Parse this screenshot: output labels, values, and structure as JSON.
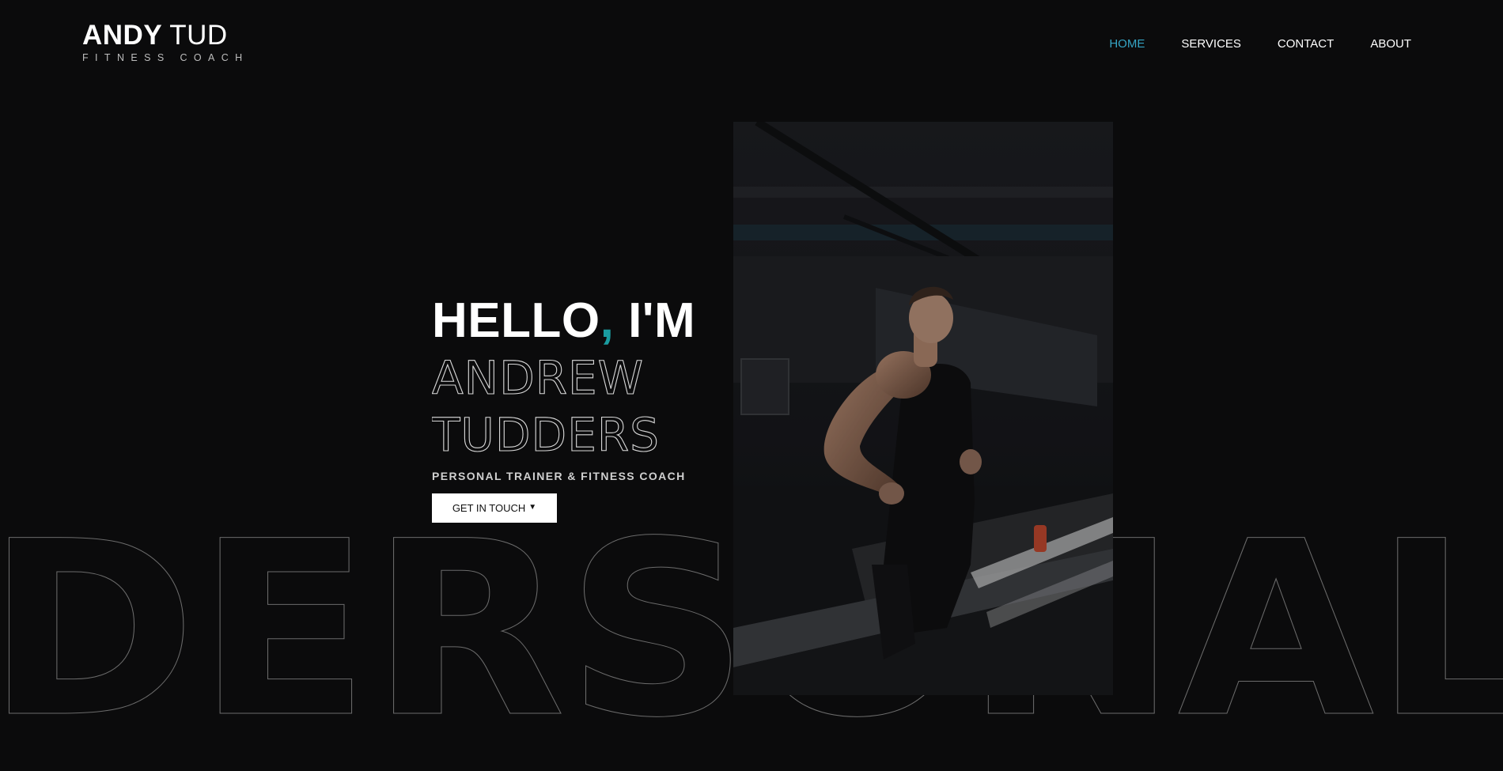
{
  "logo": {
    "title_bold": "ANDY",
    "title_light": "TUD",
    "subtitle": "FITNESS COACH"
  },
  "nav": {
    "items": [
      {
        "label": "HOME",
        "active": true
      },
      {
        "label": "SERVICES",
        "active": false
      },
      {
        "label": "CONTACT",
        "active": false
      },
      {
        "label": "ABOUT",
        "active": false
      }
    ]
  },
  "hero": {
    "greeting_word": "HELLO",
    "greeting_comma": ",",
    "greeting_rest": " I'M",
    "name_line1": "ANDREW",
    "name_line2": "TUDDERS",
    "subtitle": "PERSONAL TRAINER & FITNESS COACH",
    "cta_label": "GET IN TOUCH",
    "cta_icon": "chevron-down-icon"
  },
  "background_word": "DERSONAL",
  "photo": {
    "subject": "man running on treadmill in dark gym"
  },
  "colors": {
    "background": "#0b0b0c",
    "accent": "#35a4c4",
    "comma_accent": "#1a9ca0",
    "text": "#ffffff"
  }
}
